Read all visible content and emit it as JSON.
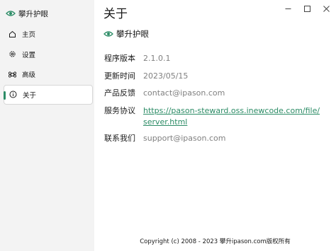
{
  "app": {
    "name": "攀升护眼"
  },
  "sidebar": {
    "items": [
      {
        "label": "主页",
        "icon": "home-icon"
      },
      {
        "label": "设置",
        "icon": "gear-icon"
      },
      {
        "label": "高级",
        "icon": "command-icon"
      },
      {
        "label": "关于",
        "icon": "info-icon",
        "active": true
      }
    ]
  },
  "main": {
    "title": "关于",
    "app_name": "攀升护眼",
    "rows": [
      {
        "label": "程序版本",
        "value": "2.1.0.1"
      },
      {
        "label": "更新时间",
        "value": "2023/05/15"
      },
      {
        "label": "产品反馈",
        "value": "contact@ipason.com"
      },
      {
        "label": "服务协议",
        "value_line1": "https://pason-steward.oss.inewcode.com/file/",
        "value_line2": "server.html"
      },
      {
        "label": "联系我们",
        "value": "support@ipason.com"
      }
    ],
    "footer": "Copyright (c) 2008 - 2023 攀升ipason.com版权所有"
  },
  "window_controls": {
    "minimize": "minimize-icon",
    "maximize": "maximize-icon",
    "close": "close-icon"
  },
  "colors": {
    "accent": "#2c8c66",
    "muted_text": "#808080",
    "sidebar_bg": "#f3f3f3",
    "content_bg": "#ffffff"
  }
}
